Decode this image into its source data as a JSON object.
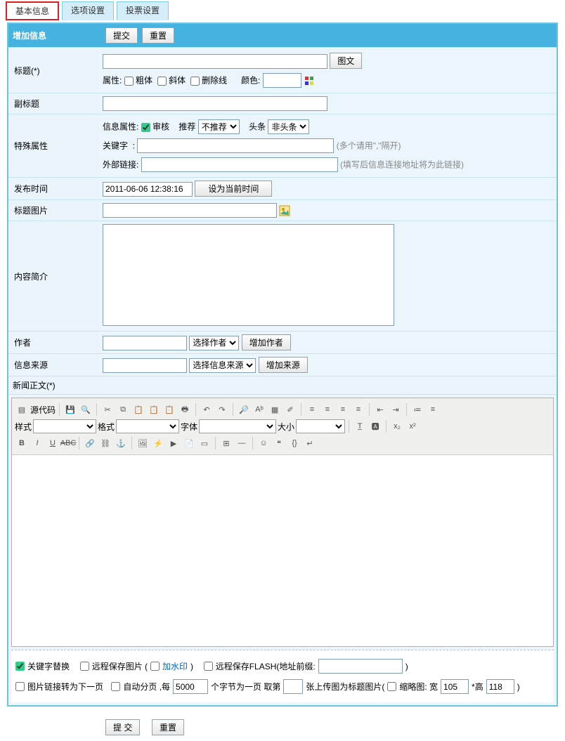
{
  "tabs": [
    "基本信息",
    "选项设置",
    "投票设置"
  ],
  "header": {
    "title": "增加信息",
    "submit": "提交",
    "reset": "重置"
  },
  "labels": {
    "title": "标题(*)",
    "subtitle": "副标题",
    "special": "特殊属性",
    "pubtime": "发布时间",
    "titlepic": "标题图片",
    "summary": "内容简介",
    "author": "作者",
    "source": "信息来源",
    "body": "新闻正文(*)"
  },
  "title_row": {
    "tuwen": "图文",
    "attr": "属性:",
    "bold": "粗体",
    "italic": "斜体",
    "strike": "删除线",
    "color": "颜色:"
  },
  "special": {
    "infoattr": "信息属性:",
    "audit": "审核",
    "recommend": "推荐",
    "rec_opt": "不推荐",
    "headline": "头条",
    "head_opt": "非头条",
    "keyword": "关键字",
    "keyword_hint": "(多个请用\",\"隔开)",
    "extlink": "外部链接:",
    "extlink_hint": "(填写后信息连接地址将为此链接)"
  },
  "pubtime": {
    "value": "2011-06-06 12:38:16",
    "setnow": "设为当前时间"
  },
  "author": {
    "sel": "选择作者",
    "add": "增加作者"
  },
  "source": {
    "sel": "选择信息来源",
    "add": "增加来源"
  },
  "toolbar": {
    "src": "源代码",
    "style": "样式",
    "format": "格式",
    "font": "字体",
    "size": "大小"
  },
  "opts": {
    "kw": "关键字替换",
    "remote_img": "远程保存图片 (",
    "watermark": "加水印",
    "paren": ")",
    "remote_flash": "远程保存FLASH(地址前缀:",
    "imglink": "图片链接转为下一页",
    "autopage": "自动分页 ,每",
    "autopage2": "个字节为一页   取第",
    "autopage3": "张上传图为标题图片(",
    "thumb": "缩略图: 宽",
    "height": "*高",
    "autopage_v": "5000",
    "thumb_w": "105",
    "thumb_h": "118"
  },
  "bottom": {
    "submit": "提 交",
    "reset": "重置"
  }
}
